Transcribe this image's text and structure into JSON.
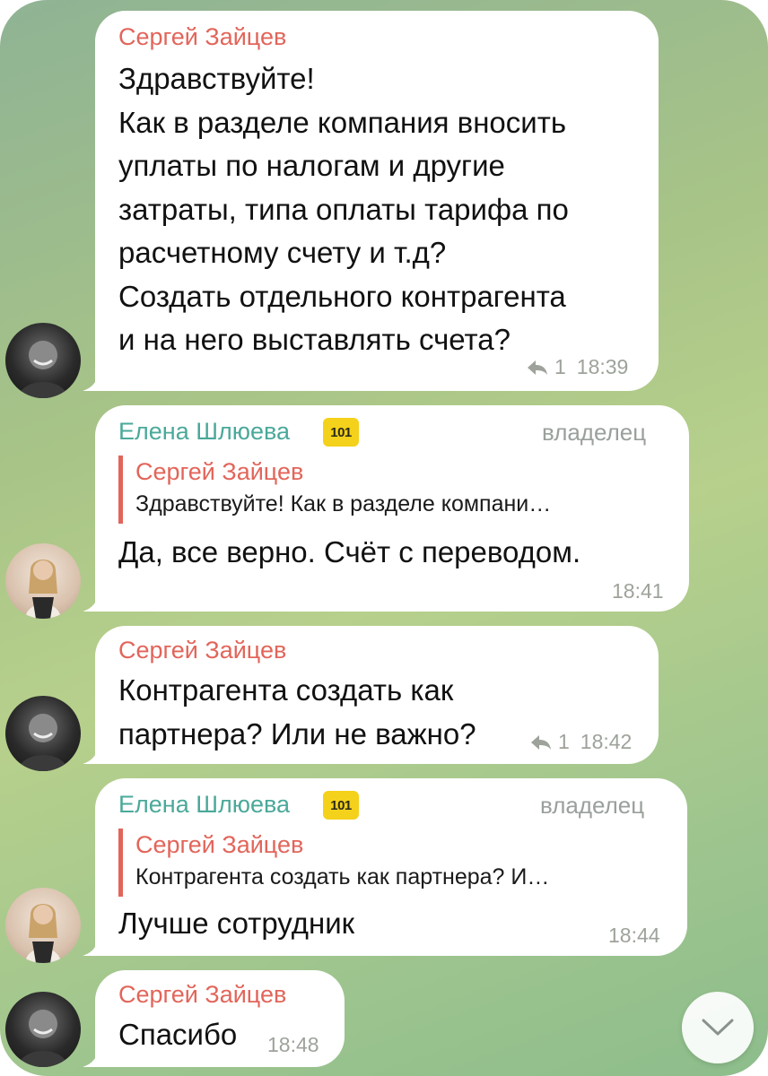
{
  "messages": [
    {
      "sender": "Сергей Зайцев",
      "lines": [
        "Здравствуйте!",
        "Как в разделе компания вносить",
        "уплаты по налогам и другие",
        "затраты, типа оплаты тарифа по",
        "расчетному счету и т.д?",
        "Создать отдельного контрагента",
        "и на него выставлять счета?"
      ],
      "reply_count": "1",
      "time": "18:39"
    },
    {
      "sender": "Елена Шлюева",
      "badge": "101",
      "role": "владелец",
      "quote_sender": "Сергей Зайцев",
      "quote_text": "Здравствуйте! Как в разделе компани…",
      "text": "Да, все верно. Счёт с переводом.",
      "time": "18:41"
    },
    {
      "sender": "Сергей Зайцев",
      "lines": [
        "Контрагента создать как",
        "партнера? Или не важно?"
      ],
      "reply_count": "1",
      "time": "18:42"
    },
    {
      "sender": "Елена Шлюева",
      "badge": "101",
      "role": "владелец",
      "quote_sender": "Сергей Зайцев",
      "quote_text": "Контрагента создать как партнера? И…",
      "text": "Лучше сотрудник",
      "time": "18:44"
    },
    {
      "sender": "Сергей Зайцев",
      "text": "Спасибо",
      "time": "18:48"
    }
  ],
  "icons": {
    "reply": "reply-arrow-icon",
    "scroll_down": "chevron-down-icon"
  },
  "colors": {
    "sender_sergey": "#e2655a",
    "sender_elena": "#4aa99a",
    "badge": "#f4d11a"
  }
}
